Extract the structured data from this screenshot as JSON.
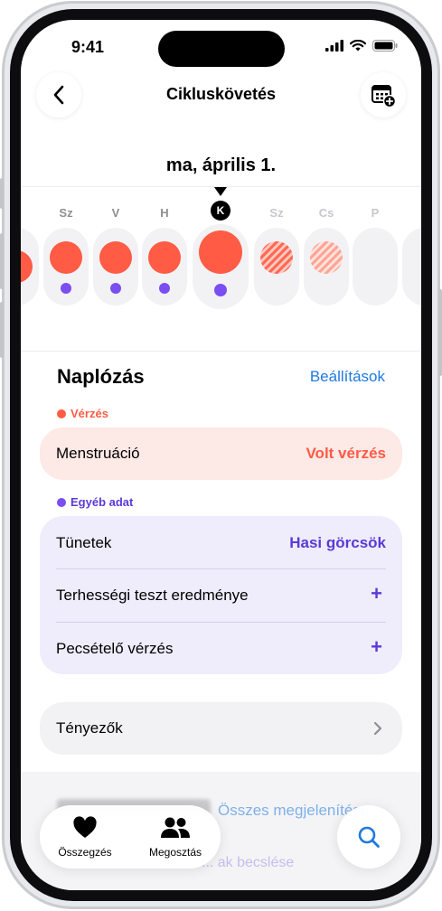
{
  "status": {
    "time": "9:41"
  },
  "nav": {
    "title": "Cikluskövetés",
    "back_icon": "chevron-left-icon",
    "calendar_icon": "calendar-add-icon"
  },
  "date_label": "ma, április 1.",
  "days": [
    {
      "letter": "Sz",
      "state": "logged",
      "symptom": true
    },
    {
      "letter": "V",
      "state": "logged",
      "symptom": true
    },
    {
      "letter": "H",
      "state": "logged",
      "symptom": true
    },
    {
      "letter": "K",
      "state": "today-logged",
      "symptom": true
    },
    {
      "letter": "Sz",
      "state": "predicted"
    },
    {
      "letter": "Cs",
      "state": "predicted-light"
    },
    {
      "letter": "P",
      "state": "empty"
    }
  ],
  "logging": {
    "title": "Naplózás",
    "settings_link": "Beállítások",
    "bleeding_section": {
      "label": "Vérzés",
      "color": "#ff5b45"
    },
    "menstruation": {
      "label": "Menstruáció",
      "value": "Volt vérzés",
      "value_color": "#ff5b45"
    },
    "other_section": {
      "label": "Egyéb adat",
      "color": "#7a4ef0"
    },
    "rows": [
      {
        "label": "Tünetek",
        "value": "Hasi görcsök"
      },
      {
        "label": "Terhességi teszt eredménye",
        "value": "+"
      },
      {
        "label": "Pecsételő vérzés",
        "value": "+"
      }
    ],
    "factors": {
      "label": "Tényezők"
    }
  },
  "bottom": {
    "link": "Összes megjelenítése",
    "sub": "... ak becslése"
  },
  "tabbar": {
    "summary_label": "Összegzés",
    "sharing_label": "Megosztás"
  },
  "colors": {
    "accent_blue": "#1f7ae0",
    "accent_purple": "#5b3ad6",
    "flow_red": "#ff5b45"
  }
}
